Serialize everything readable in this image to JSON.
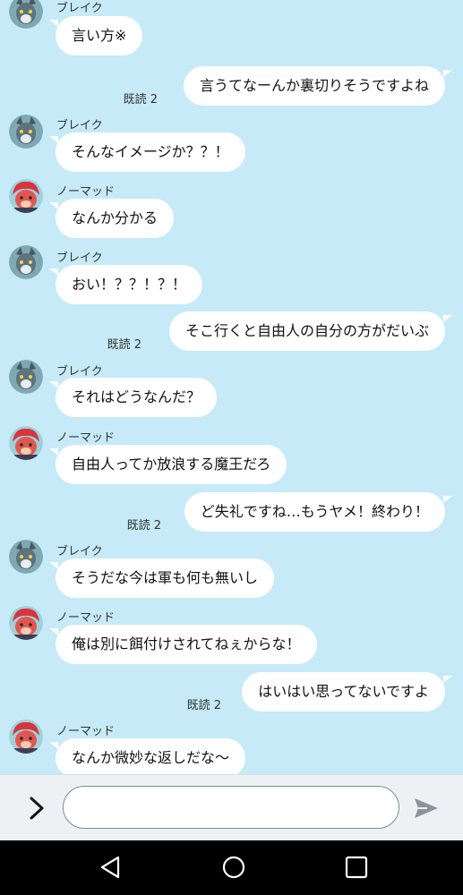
{
  "chat": {
    "messages": [
      {
        "side": "in",
        "sender": "ブレイク",
        "avatar": "blake",
        "text": "言い方※"
      },
      {
        "side": "out",
        "read": "既読 2",
        "text": "言うてなーんか裏切りそうですよね"
      },
      {
        "side": "in",
        "sender": "ブレイク",
        "avatar": "blake",
        "text": "そんなイメージか？？！"
      },
      {
        "side": "in",
        "sender": "ノーマッド",
        "avatar": "nomad",
        "text": "なんか分かる"
      },
      {
        "side": "in",
        "sender": "ブレイク",
        "avatar": "blake",
        "text": "おい！？？！？！"
      },
      {
        "side": "out",
        "read": "既読 2",
        "text": "そこ行くと自由人の自分の方がだいぶ"
      },
      {
        "side": "in",
        "sender": "ブレイク",
        "avatar": "blake",
        "text": "それはどうなんだ？"
      },
      {
        "side": "in",
        "sender": "ノーマッド",
        "avatar": "nomad",
        "text": "自由人ってか放浪する魔王だろ"
      },
      {
        "side": "out",
        "read": "既読 2",
        "text": "ど失礼ですね…もうヤメ！終わり！"
      },
      {
        "side": "in",
        "sender": "ブレイク",
        "avatar": "blake",
        "text": "そうだな今は軍も何も無いし"
      },
      {
        "side": "in",
        "sender": "ノーマッド",
        "avatar": "nomad",
        "text": "俺は別に餌付けされてねぇからな！"
      },
      {
        "side": "out",
        "read": "既読 2",
        "text": "はいはい思ってないですよ"
      },
      {
        "side": "in",
        "sender": "ノーマッド",
        "avatar": "nomad",
        "text": "なんか微妙な返しだな〜"
      }
    ]
  },
  "input": {
    "placeholder": "",
    "value": ""
  },
  "icons": {
    "expand": "chevron-right-icon",
    "send": "send-icon",
    "back": "nav-back-icon",
    "home": "nav-home-icon",
    "recents": "nav-recents-icon"
  },
  "colors": {
    "chat_background": "#c6eaf7",
    "bubble": "#ffffff",
    "input_bar": "#eef1f4",
    "nav_bar": "#000000",
    "send_icon": "#8a949c"
  }
}
